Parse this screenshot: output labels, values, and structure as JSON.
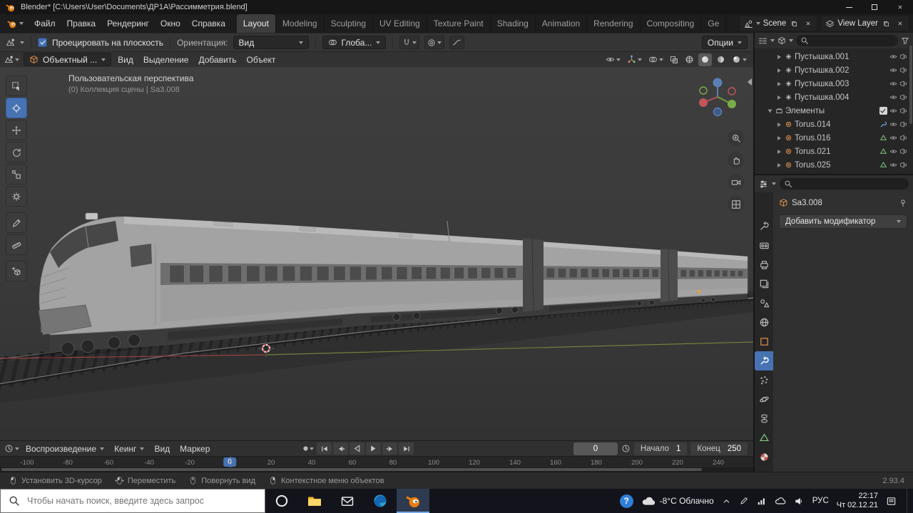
{
  "titlebar": {
    "title": "Blender* [C:\\Users\\User\\Documents\\ДР1А\\Рассимметрия.blend]"
  },
  "topbar": {
    "menus": [
      "Файл",
      "Правка",
      "Рендеринг",
      "Окно",
      "Справка"
    ],
    "tabs": [
      "Layout",
      "Modeling",
      "Sculpting",
      "UV Editing",
      "Texture Paint",
      "Shading",
      "Animation",
      "Rendering",
      "Compositing",
      "Ge"
    ],
    "active_tab": "Layout",
    "scene_label": "Scene",
    "view_layer_label": "View Layer"
  },
  "tool_settings": {
    "project_label": "Проецировать на плоскость",
    "orientation_label": "Ориентация:",
    "orientation_value": "Вид",
    "pivot_value": "Глоба...",
    "options_label": "Опции"
  },
  "view_header": {
    "mode_value": "Объектный ...",
    "menus": [
      "Вид",
      "Выделение",
      "Добавить",
      "Объект"
    ]
  },
  "viewport": {
    "overlay_title": "Пользовательская перспектива",
    "overlay_subtitle": "(0) Коллекция сцены | Sa3.008",
    "tools": [
      "select-box",
      "cursor",
      "move",
      "rotate",
      "scale",
      "transform",
      "annotate",
      "measure",
      "add-cube"
    ],
    "active_tool": "cursor"
  },
  "outliner": {
    "rows": [
      {
        "label": "Пустышка.001",
        "type": "empty",
        "depth": 2
      },
      {
        "label": "Пустышка.002",
        "type": "empty",
        "depth": 2
      },
      {
        "label": "Пустышка.003",
        "type": "empty",
        "depth": 2
      },
      {
        "label": "Пустышка.004",
        "type": "empty",
        "depth": 2
      },
      {
        "label": "Элементы",
        "type": "collection",
        "depth": 1,
        "checked": true,
        "expanded": true
      },
      {
        "label": "Torus.014",
        "type": "mesh",
        "depth": 2,
        "badge": "modifier"
      },
      {
        "label": "Torus.016",
        "type": "mesh",
        "depth": 2,
        "badge": "data"
      },
      {
        "label": "Torus.021",
        "type": "mesh",
        "depth": 2,
        "badge": "data"
      },
      {
        "label": "Torus.025",
        "type": "mesh",
        "depth": 2,
        "badge": "data"
      },
      {
        "label": "",
        "type": "mesh",
        "depth": 2
      }
    ]
  },
  "properties": {
    "breadcrumb": "Sa3.008",
    "add_modifier_label": "Добавить модификатор",
    "tabs": [
      "tool",
      "render",
      "output",
      "view-layer",
      "scene",
      "world",
      "object",
      "modifiers",
      "particles",
      "physics",
      "constraints",
      "data",
      "material",
      "texture"
    ],
    "active_tab": "modifiers"
  },
  "timeline": {
    "menus": [
      "Воспроизведение",
      "Кеинг",
      "Вид",
      "Маркер"
    ],
    "current_frame": "0",
    "frame_field": "0",
    "start_label": "Начало",
    "start_value": "1",
    "end_label": "Конец",
    "end_value": "250",
    "ticks": [
      "-100",
      "-80",
      "-60",
      "-40",
      "-20",
      "0",
      "20",
      "40",
      "60",
      "80",
      "100",
      "120",
      "140",
      "160",
      "180",
      "200",
      "220",
      "240"
    ]
  },
  "statusbar": {
    "items": [
      "Установить 3D-курсор",
      "Переместить",
      "Повернуть вид",
      "Контекстное меню объектов"
    ],
    "version": "2.93.4"
  },
  "taskbar": {
    "search_placeholder": "Чтобы начать поиск, введите здесь запрос",
    "apps": [
      "cortana",
      "explorer",
      "mail",
      "edge",
      "blender"
    ],
    "active_app": "blender",
    "help_glyph": "?",
    "weather": "-8°C Облачно",
    "language": "РУС",
    "time": "22:17",
    "date": "Чт 02.12.21"
  },
  "colors": {
    "accent": "#4772b3",
    "object_orange": "#e0904d",
    "mesh_green": "#7fc97f",
    "blender_orange": "#e87d0d"
  }
}
